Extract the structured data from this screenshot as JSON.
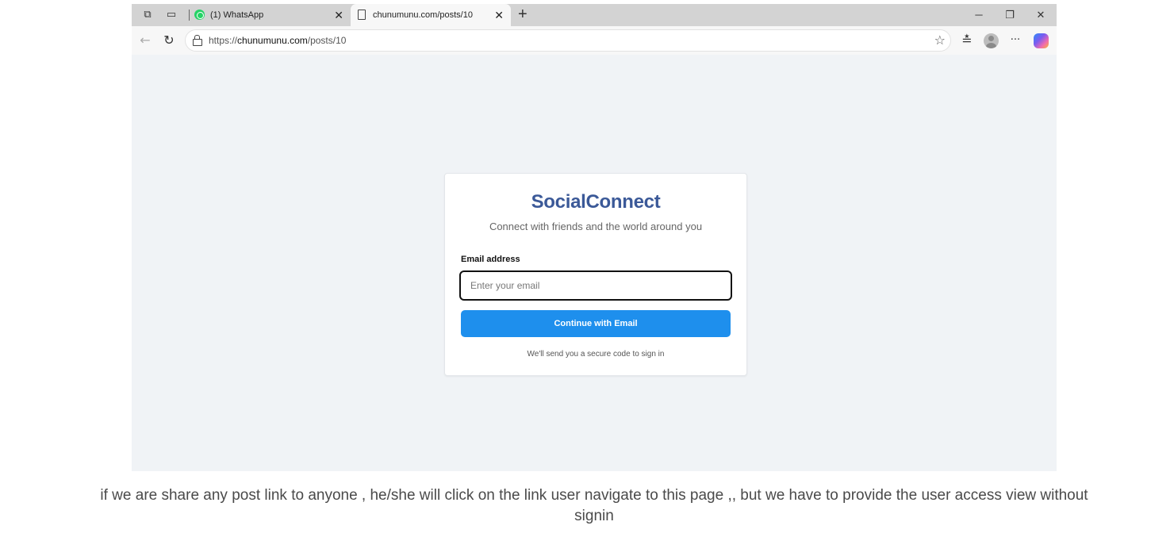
{
  "browser": {
    "tabs": [
      {
        "title": "(1) WhatsApp",
        "active": false,
        "icon": "whatsapp-icon"
      },
      {
        "title": "chunumunu.com/posts/10",
        "active": true,
        "icon": "page-icon"
      }
    ],
    "address": {
      "url_prefix": "https://",
      "url_domain": "chunumunu.com",
      "url_path": "/posts/10"
    },
    "glyphs": {
      "workspaces": "⧉",
      "sidebar": "▭",
      "close": "✕",
      "new_tab": "+",
      "minimize": "─",
      "restore": "❐",
      "back": "←",
      "refresh": "↻",
      "favorites_star": "☆",
      "favorites_list": "≛",
      "more": "···"
    }
  },
  "login": {
    "brand": "SocialConnect",
    "tagline": "Connect with friends and the world around you",
    "email_label": "Email address",
    "email_placeholder": "Enter your email",
    "email_value": "",
    "submit_label": "Continue with Email",
    "hint": "We'll send you a secure code to sign in"
  },
  "caption": "if we are share any post link to anyone , he/she will click on the link user navigate to this page ,, but we have to provide the user access view without signin",
  "colors": {
    "brand": "#3b5998",
    "button": "#1e8fed",
    "page_background": "#f0f3f6",
    "whatsapp": "#25d366"
  }
}
